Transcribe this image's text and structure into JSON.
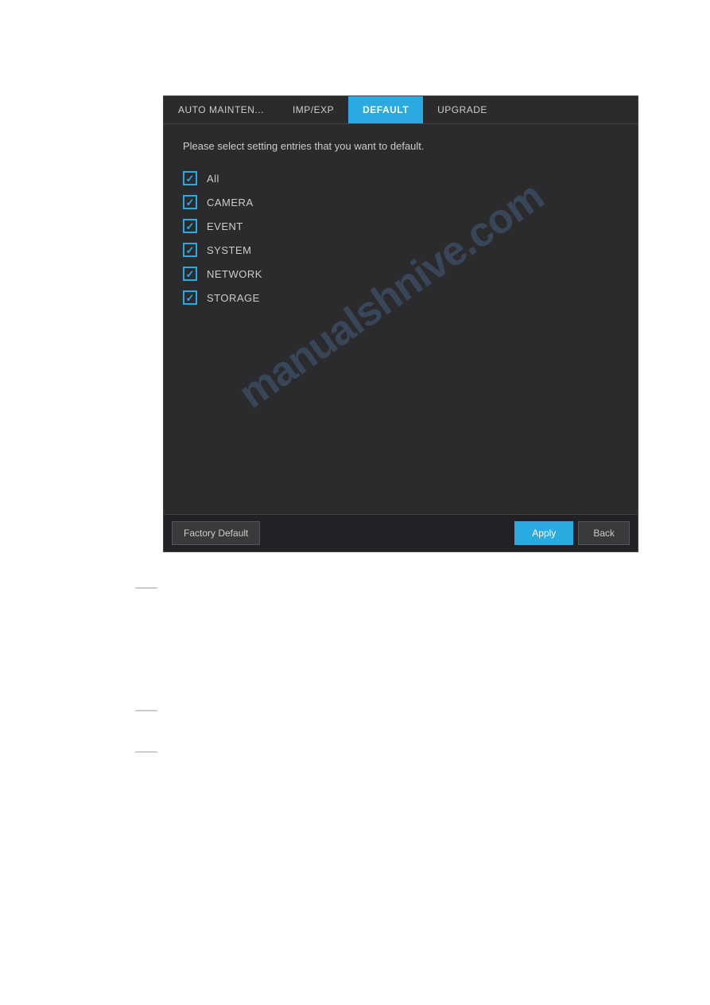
{
  "tabs": [
    {
      "id": "auto-maint",
      "label": "AUTO MAINTEN...",
      "active": false
    },
    {
      "id": "imp-exp",
      "label": "IMP/EXP",
      "active": false
    },
    {
      "id": "default",
      "label": "DEFAULT",
      "active": true
    },
    {
      "id": "upgrade",
      "label": "UPGRADE",
      "active": false
    }
  ],
  "instruction": "Please select setting entries that you want to default.",
  "checkboxes": [
    {
      "id": "all",
      "label": "All",
      "checked": true
    },
    {
      "id": "camera",
      "label": "CAMERA",
      "checked": true
    },
    {
      "id": "event",
      "label": "EVENT",
      "checked": true
    },
    {
      "id": "system",
      "label": "SYSTEM",
      "checked": true
    },
    {
      "id": "network",
      "label": "NETWORK",
      "checked": true
    },
    {
      "id": "storage",
      "label": "STORAGE",
      "checked": true
    }
  ],
  "buttons": {
    "factory_default": "Factory Default",
    "apply": "Apply",
    "back": "Back"
  },
  "watermark": {
    "line1": "manualshnive.com"
  }
}
